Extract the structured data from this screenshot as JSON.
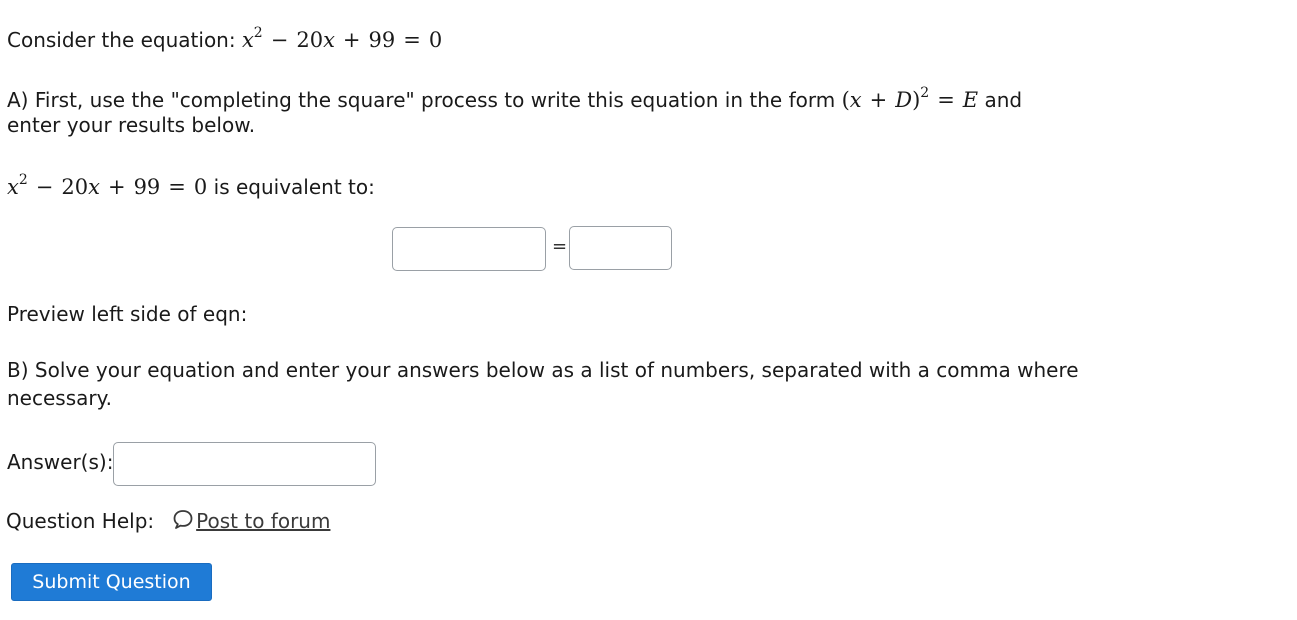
{
  "question": {
    "intro_text": "Consider the equation: ",
    "equation": {
      "x": "x",
      "exp": "2",
      "minus": "−",
      "term": "20",
      "term_var": "x",
      "plus": "+",
      "const": "99",
      "eq": "=",
      "rhs": "0"
    },
    "part_a": {
      "text_before": "A) First, use the \"completing the square\" process to write this equation in the form ",
      "form": {
        "open": "(",
        "x": "x",
        "plus": "+",
        "D": "D",
        "close": ")",
        "exp": "2",
        "eq": "=",
        "E": "E"
      },
      "text_after": " and",
      "text_line2": "enter your results below.",
      "equivalent_to": " is equivalent to:"
    },
    "answer_a": {
      "left_value": "",
      "equals": "=",
      "right_value": ""
    },
    "preview_label": "Preview left side of eqn:",
    "part_b": {
      "line1": "B) Solve your equation and enter your answers below as a list of numbers, separated with a comma where",
      "line2": "necessary."
    },
    "answers_label": "Answer(s):",
    "answers_value": "",
    "help": {
      "label": "Question Help:",
      "link": "Post to forum",
      "icon": "chat-bubble-icon"
    },
    "submit_label": "Submit Question"
  },
  "colors": {
    "accent": "#1f7bd6",
    "text": "#1a1a1a",
    "border": "#9aa0a6"
  }
}
